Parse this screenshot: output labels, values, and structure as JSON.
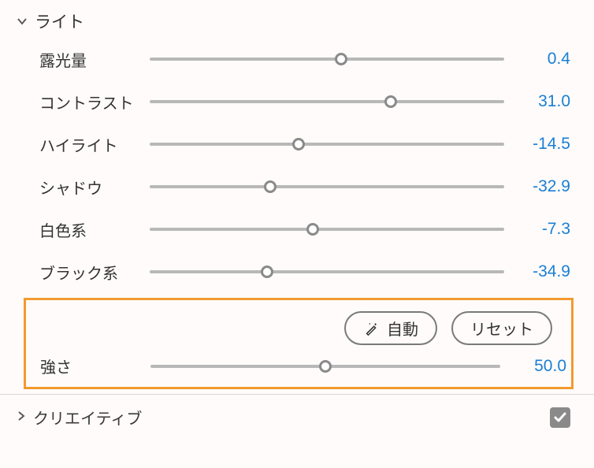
{
  "sections": {
    "light": {
      "title": "ライト",
      "expanded": true,
      "sliders": [
        {
          "label": "露光量",
          "value": "0.4",
          "pos": 54
        },
        {
          "label": "コントラスト",
          "value": "31.0",
          "pos": 68
        },
        {
          "label": "ハイライト",
          "value": "-14.5",
          "pos": 42
        },
        {
          "label": "シャドウ",
          "value": "-32.9",
          "pos": 34
        },
        {
          "label": "白色系",
          "value": "-7.3",
          "pos": 46
        },
        {
          "label": "ブラック系",
          "value": "-34.9",
          "pos": 33
        }
      ],
      "auto_label": "自動",
      "reset_label": "リセット",
      "strength": {
        "label": "強さ",
        "value": "50.0",
        "pos": 50
      }
    },
    "creative": {
      "title": "クリエイティブ",
      "expanded": false,
      "checked": true
    }
  }
}
